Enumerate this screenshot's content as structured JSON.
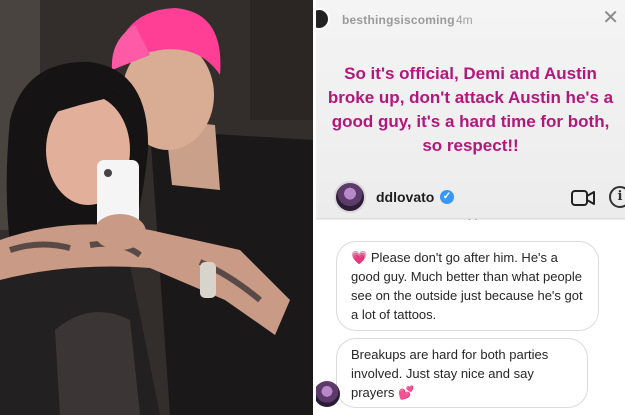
{
  "story": {
    "username": "besthingsiscoming",
    "time": "4m",
    "close_symbol": "✕",
    "caption": "So it's official, Demi and Austin broke up, don't attack Austin he's a good guy, it's a hard time for both, so respect!!",
    "caption_color": "#b0187a"
  },
  "profile": {
    "name": "ddlovato",
    "verified_symbol": "✓",
    "video_icon": "video-camera-icon",
    "info_symbol": "i"
  },
  "messages": [
    {
      "text": "Please don't go after him. He's a good guy. Much better than what people see on the outside just because he's got a lot of tattoos.",
      "prefix": "💗",
      "suffix": ""
    },
    {
      "text": "Breakups are hard for both parties involved. Just stay nice and say prayers",
      "prefix": "",
      "suffix": "💕"
    }
  ],
  "colors": {
    "verified": "#3897f0",
    "heart": "#e85fb6"
  }
}
